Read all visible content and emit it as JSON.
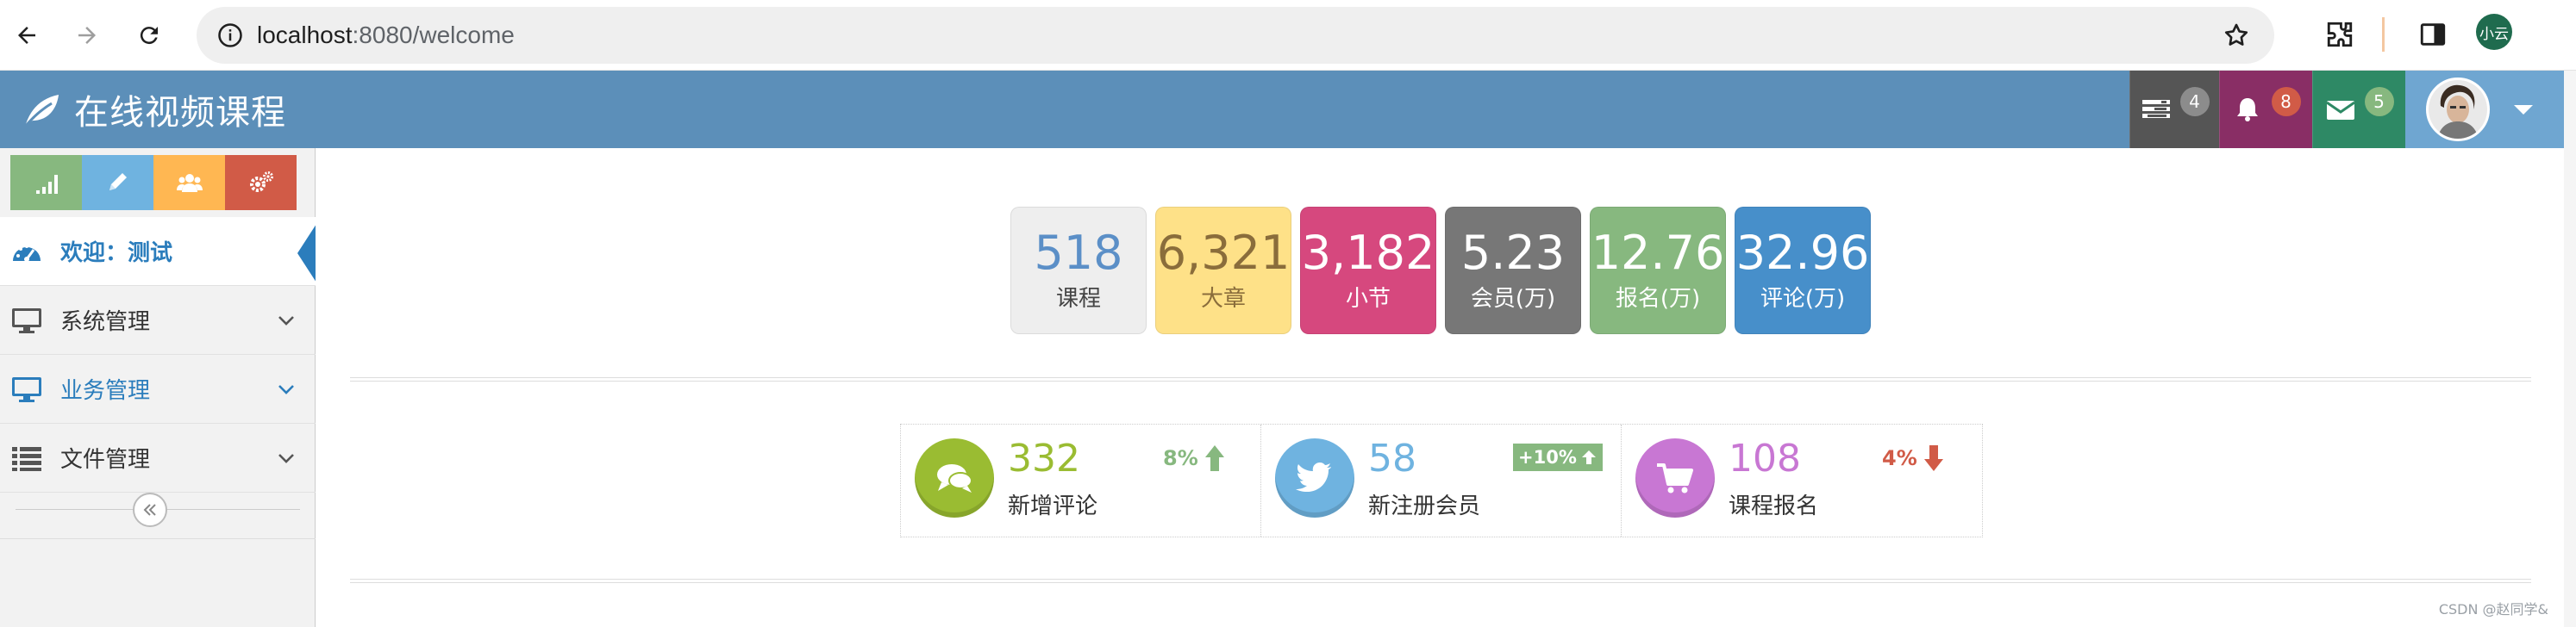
{
  "browser": {
    "url_host": "localhost",
    "url_rest": ":8080/welcome",
    "profile_label": "小云"
  },
  "header": {
    "brand_title": "在线视频课程",
    "tasks_count": "4",
    "notifications_count": "8",
    "messages_count": "5",
    "colors": {
      "bar": "#5c8fb9",
      "tasks_bg": "#555555",
      "notifications_bg": "#892e65",
      "messages_bg": "#2e8965",
      "user_bg": "#6fa6d1"
    }
  },
  "sidebar": {
    "shortcuts": [
      {
        "name": "chart-icon",
        "color": "#87b87f"
      },
      {
        "name": "pencil-icon",
        "color": "#6fb3e0"
      },
      {
        "name": "users-icon",
        "color": "#ffb752"
      },
      {
        "name": "cogs-icon",
        "color": "#d15b47"
      }
    ],
    "items": [
      {
        "label": "欢迎：测试",
        "icon": "dashboard-icon",
        "active": true
      },
      {
        "label": "系统管理",
        "icon": "desktop-icon"
      },
      {
        "label": "业务管理",
        "icon": "desktop-icon"
      },
      {
        "label": "文件管理",
        "icon": "list-icon"
      }
    ]
  },
  "stat_boxes": [
    {
      "value": "518",
      "label": "课程",
      "bg": "#eeeeee",
      "fg": "#5b8fc7",
      "label_fg": "#444444"
    },
    {
      "value": "6,321",
      "label": "大章",
      "bg": "#fee188",
      "fg": "#8a6d3b",
      "label_fg": "#8a6d3b"
    },
    {
      "value": "3,182",
      "label": "小节",
      "bg": "#d6487e",
      "fg": "#ffffff",
      "label_fg": "#ffffff"
    },
    {
      "value": "5.23",
      "label": "会员(万)",
      "bg": "#777777",
      "fg": "#ffffff",
      "label_fg": "#ffffff"
    },
    {
      "value": "12.76",
      "label": "报名(万)",
      "bg": "#87b87f",
      "fg": "#ffffff",
      "label_fg": "#ffffff"
    },
    {
      "value": "32.96",
      "label": "评论(万)",
      "bg": "#478fca",
      "fg": "#ffffff",
      "label_fg": "#ffffff"
    }
  ],
  "infoboxes": [
    {
      "value": "332",
      "label": "新增评论",
      "icon": "comments-icon",
      "circle": "#9abc32",
      "value_color": "#9abc32",
      "stat": "8%",
      "stat_color": "#87b87f",
      "trend": "up"
    },
    {
      "value": "58",
      "label": "新注册会员",
      "icon": "twitter-icon",
      "circle": "#6fb3e0",
      "value_color": "#6fb3e0",
      "stat": "+10%",
      "trend": "up"
    },
    {
      "value": "108",
      "label": "课程报名",
      "icon": "shopping-cart-icon",
      "circle": "#c877d3",
      "value_color": "#c877d3",
      "stat": "4%",
      "stat_color": "#d15b47",
      "trend": "down"
    }
  ],
  "watermark": "CSDN @赵同学&"
}
